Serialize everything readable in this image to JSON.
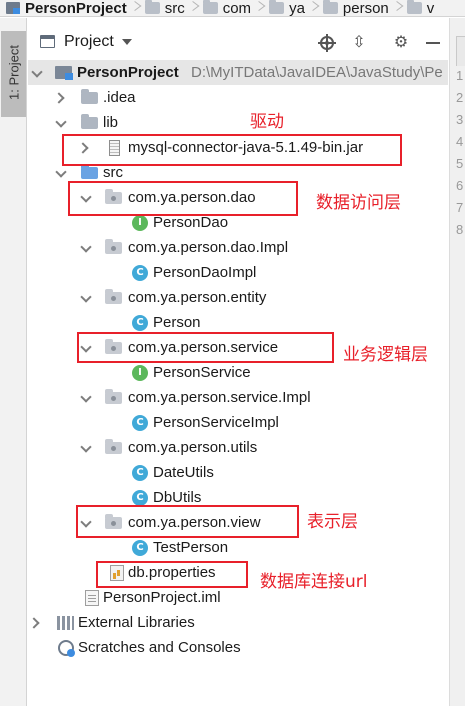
{
  "breadcrumb": [
    "PersonProject",
    "src",
    "com",
    "ya",
    "person",
    "v"
  ],
  "tool_strip": {
    "project_tab": "1: Project"
  },
  "panel": {
    "title": "Project"
  },
  "gutter_numbers": [
    "1",
    "2",
    "3",
    "4",
    "5",
    "6",
    "7",
    "8"
  ],
  "tree": [
    {
      "label": "PersonProject",
      "hint": "D:\\MyITData\\JavaIDEA\\JavaStudy\\Pe",
      "bold": true,
      "icon": "module-icon"
    },
    {
      "label": ".idea",
      "icon": "folder-icon"
    },
    {
      "label": "lib",
      "icon": "folder-icon"
    },
    {
      "label": "mysql-connector-java-5.1.49-bin.jar",
      "icon": "jar-icon"
    },
    {
      "label": "src",
      "icon": "source-folder-icon"
    },
    {
      "label": "com.ya.person.dao",
      "icon": "package-icon"
    },
    {
      "label": "PersonDao",
      "icon": "interface-icon"
    },
    {
      "label": "com.ya.person.dao.Impl",
      "icon": "package-icon"
    },
    {
      "label": "PersonDaoImpl",
      "icon": "class-icon"
    },
    {
      "label": "com.ya.person.entity",
      "icon": "package-icon"
    },
    {
      "label": "Person",
      "icon": "class-icon"
    },
    {
      "label": "com.ya.person.service",
      "icon": "package-icon"
    },
    {
      "label": "PersonService",
      "icon": "interface-icon"
    },
    {
      "label": "com.ya.person.service.Impl",
      "icon": "package-icon"
    },
    {
      "label": "PersonServiceImpl",
      "icon": "class-icon"
    },
    {
      "label": "com.ya.person.utils",
      "icon": "package-icon"
    },
    {
      "label": "DateUtils",
      "icon": "class-icon"
    },
    {
      "label": "DbUtils",
      "icon": "class-icon"
    },
    {
      "label": "com.ya.person.view",
      "icon": "package-icon"
    },
    {
      "label": "TestPerson",
      "icon": "class-icon"
    },
    {
      "label": "db.properties",
      "icon": "properties-file-icon"
    },
    {
      "label": "PersonProject.iml",
      "icon": "iml-file-icon"
    },
    {
      "label": "External Libraries",
      "icon": "libraries-icon"
    },
    {
      "label": "Scratches and Consoles",
      "icon": "scratches-icon"
    }
  ],
  "class_badge": "C",
  "interface_badge": "I",
  "annotations": {
    "driver": "驱动",
    "data_access_layer": "数据访问层",
    "business_logic_layer": "业务逻辑层",
    "presentation_layer": "表示层",
    "db_connection_url": "数据库连接url"
  },
  "colors": {
    "annotation": "#e8202a",
    "class_icon": "#40a9d8",
    "interface_icon": "#5cb85c",
    "selected_row": "#e6e6e6"
  }
}
